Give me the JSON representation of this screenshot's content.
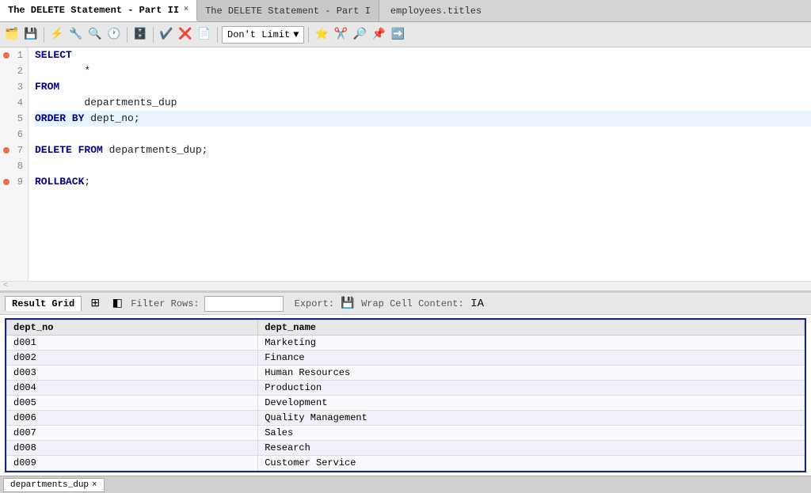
{
  "tabs": [
    {
      "id": "tab1",
      "label": "The DELETE Statement - Part II",
      "active": true
    },
    {
      "id": "tab2",
      "label": "The DELETE Statement - Part I",
      "active": false
    },
    {
      "id": "tab3",
      "label": "employees.titles",
      "active": false
    }
  ],
  "toolbar": {
    "dropdown_label": "Don't Limit",
    "icons": [
      "folder-open",
      "save",
      "pipe",
      "lightning",
      "magnify",
      "clock",
      "db",
      "check",
      "x",
      "file",
      "dropdown",
      "star",
      "scissors",
      "search",
      "pin",
      "arrow-right"
    ]
  },
  "editor": {
    "lines": [
      {
        "num": 1,
        "dot": true,
        "highlighted": false,
        "content": "SELECT",
        "tokens": [
          {
            "type": "kw",
            "text": "SELECT"
          }
        ]
      },
      {
        "num": 2,
        "dot": false,
        "highlighted": false,
        "content": "        *",
        "tokens": [
          {
            "type": "plain",
            "text": "        *"
          }
        ]
      },
      {
        "num": 3,
        "dot": false,
        "highlighted": false,
        "content": "FROM",
        "tokens": [
          {
            "type": "kw",
            "text": "FROM"
          }
        ]
      },
      {
        "num": 4,
        "dot": false,
        "highlighted": false,
        "content": "        departments_dup",
        "tokens": [
          {
            "type": "plain",
            "text": "        departments_dup"
          }
        ]
      },
      {
        "num": 5,
        "dot": false,
        "highlighted": true,
        "content": "ORDER BY dept_no;",
        "tokens": [
          {
            "type": "kw",
            "text": "ORDER BY "
          },
          {
            "type": "plain",
            "text": "dept_no;"
          }
        ]
      },
      {
        "num": 6,
        "dot": false,
        "highlighted": false,
        "content": "",
        "tokens": []
      },
      {
        "num": 7,
        "dot": true,
        "highlighted": false,
        "content": "DELETE FROM departments_dup;",
        "tokens": [
          {
            "type": "kw",
            "text": "DELETE FROM "
          },
          {
            "type": "plain",
            "text": "departments_dup;"
          }
        ]
      },
      {
        "num": 8,
        "dot": false,
        "highlighted": false,
        "content": "",
        "tokens": []
      },
      {
        "num": 9,
        "dot": true,
        "highlighted": false,
        "content": "ROLLBACK;",
        "tokens": [
          {
            "type": "kw",
            "text": "ROLLBACK"
          },
          {
            "type": "plain",
            "text": ";"
          }
        ]
      }
    ]
  },
  "result_grid": {
    "tab_label": "Result Grid",
    "filter_label": "Filter Rows:",
    "export_label": "Export:",
    "wrap_label": "Wrap Cell Content:",
    "columns": [
      "dept_no",
      "dept_name"
    ],
    "rows": [
      [
        "d001",
        "Marketing"
      ],
      [
        "d002",
        "Finance"
      ],
      [
        "d003",
        "Human Resources"
      ],
      [
        "d004",
        "Production"
      ],
      [
        "d005",
        "Development"
      ],
      [
        "d006",
        "Quality Management"
      ],
      [
        "d007",
        "Sales"
      ],
      [
        "d008",
        "Research"
      ],
      [
        "d009",
        "Customer Service"
      ]
    ]
  },
  "bottom_tab": {
    "label": "departments_dup",
    "close": "×"
  }
}
